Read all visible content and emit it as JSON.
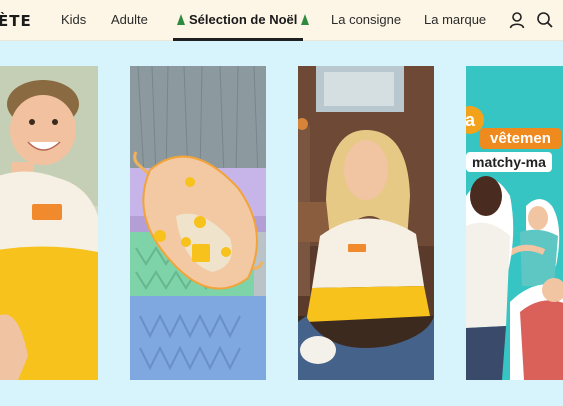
{
  "brand": {
    "logo_text": "ÈTE"
  },
  "nav": {
    "items": [
      {
        "label": "Kids",
        "active": false
      },
      {
        "label": "Adulte",
        "active": false
      },
      {
        "label": "Sélection de Noël",
        "active": true
      },
      {
        "label": "La consigne",
        "active": false
      },
      {
        "label": "La marque",
        "active": false
      }
    ],
    "icons": [
      "user-icon",
      "search-icon"
    ]
  },
  "carousel": {
    "cards": [
      {
        "image": "boy-in-yellow-sweatshirt-photo",
        "sweatshirt_print": ""
      },
      {
        "image": "fanny-pack-on-crates-photo"
      },
      {
        "image": "woman-in-yellow-sweatshirt-photo"
      },
      {
        "image": "family-collage-photo",
        "tag_a": "a",
        "tag_b": "vêtemen",
        "tag_c": "matchy-ma"
      }
    ]
  },
  "colors": {
    "page_bg": "#d7f3fb",
    "nav_bg": "#fdf6e6",
    "sweatshirt_yellow": "#f6c21b",
    "sweatshirt_cream": "#f6efe3",
    "promo_teal": "#37c5c4",
    "promo_orange": "#ef8a1f"
  }
}
